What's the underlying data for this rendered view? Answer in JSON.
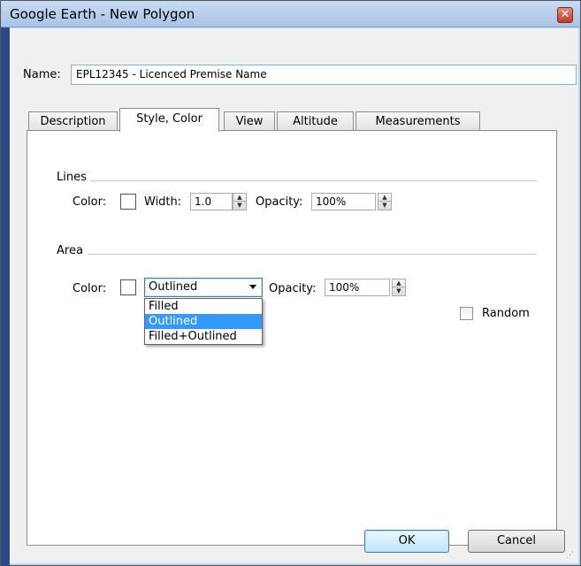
{
  "window": {
    "title": "Google Earth - New Polygon",
    "close_glyph": "✕"
  },
  "name_field": {
    "label": "Name:",
    "value": "EPL12345 - Licenced Premise Name"
  },
  "tabs": [
    {
      "label": "Description",
      "active": false
    },
    {
      "label": "Style, Color",
      "active": true
    },
    {
      "label": "View",
      "active": false
    },
    {
      "label": "Altitude",
      "active": false
    },
    {
      "label": "Measurements",
      "active": false
    }
  ],
  "lines": {
    "group_label": "Lines",
    "color_label": "Color:",
    "width_label": "Width:",
    "width_value": "1.0",
    "opacity_label": "Opacity:",
    "opacity_value": "100%"
  },
  "area": {
    "group_label": "Area",
    "color_label": "Color:",
    "mode_selected": "Outlined",
    "opacity_label": "Opacity:",
    "opacity_value": "100%",
    "options": [
      "Filled",
      "Outlined",
      "Filled+Outlined"
    ],
    "highlighted_option": "Outlined"
  },
  "random": {
    "label": "Random",
    "checked": false
  },
  "buttons": {
    "ok": "OK",
    "cancel": "Cancel"
  },
  "icons": {
    "close": "close-icon",
    "spinner_up": "▲",
    "spinner_down": "▼",
    "grip": "⋰"
  },
  "colors": {
    "selection": "#3399ff",
    "title_bar": "#bdd3ee",
    "close_button": "#c0392b"
  }
}
